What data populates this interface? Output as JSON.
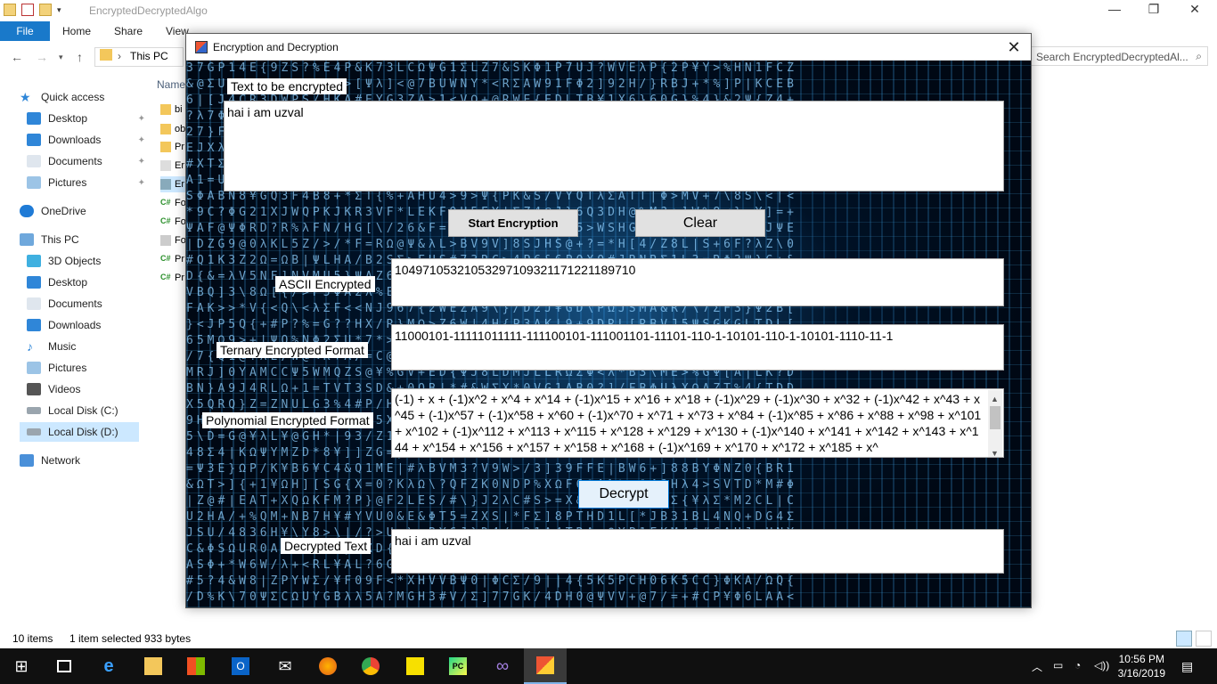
{
  "explorer": {
    "title": "EncryptedDecryptedAlgo",
    "tabs": [
      "File",
      "Home",
      "Share",
      "View"
    ],
    "address": "This PC",
    "search_placeholder": "Search EncryptedDecryptedAl...",
    "column_header": "Name",
    "nav": {
      "quick_access": "Quick access",
      "desktop": "Desktop",
      "downloads": "Downloads",
      "documents": "Documents",
      "pictures": "Pictures",
      "onedrive": "OneDrive",
      "this_pc": "This PC",
      "objects3d": "3D Objects",
      "desktop2": "Desktop",
      "documents2": "Documents",
      "downloads2": "Downloads",
      "music": "Music",
      "pictures2": "Pictures",
      "videos": "Videos",
      "local_c": "Local Disk (C:)",
      "local_d": "Local Disk (D:)",
      "network": "Network"
    },
    "files": [
      "bi",
      "ob",
      "Pr",
      "Er",
      "Er",
      "Fo",
      "Fo",
      "Fo",
      "Pr",
      "Pr"
    ],
    "status": {
      "count": "10 items",
      "selected": "1 item selected  933 bytes"
    }
  },
  "app": {
    "title": "Encryption and Decryption",
    "close": "✕",
    "labels": {
      "input": "Text to be encrypted",
      "ascii": "ASCII Encrypted",
      "ternary": "Ternary Encrypted Format",
      "polynomial": "Polynomial Encrypted Format",
      "decrypted": "Decrypted Text"
    },
    "buttons": {
      "start": "Start Encryption",
      "clear": "Clear",
      "decrypt": "Decrypt"
    },
    "values": {
      "input": "hai i am uzval",
      "ascii": "10497105321053297109321171221189710",
      "ternary": "11000101-11111011111-111100101-111001101-11101-110-1-10101-110-1-10101-1110-11-1",
      "polynomial": "(-1) + x + (-1)x^2 + x^4 + x^14 + (-1)x^15 + x^16 + x^18 + (-1)x^29 + (-1)x^30 + x^32 + (-1)x^42 + x^43 + x^45 + (-1)x^57 + (-1)x^58 + x^60 + (-1)x^70 + x^71 + x^73 + x^84 + (-1)x^85 + x^86 + x^88 + x^98 + x^101 + x^102 + (-1)x^112 + x^113 + x^115 + x^128 + x^129 + x^130 + (-1)x^140 + x^141 + x^142 + x^143 + x^144 + x^154 + x^156 + x^157 + x^158 + x^168 + (-1)x^169 + x^170 + x^172 + x^185 + x^",
      "decrypted": "hai i am uzval"
    }
  },
  "taskbar": {
    "time": "10:56 PM",
    "date": "3/16/2019"
  }
}
